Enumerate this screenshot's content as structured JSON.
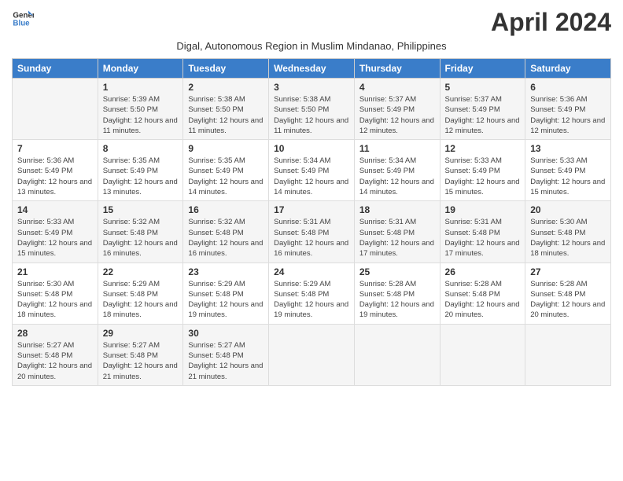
{
  "header": {
    "logo_general": "General",
    "logo_blue": "Blue",
    "title": "April 2024",
    "subtitle": "Digal, Autonomous Region in Muslim Mindanao, Philippines"
  },
  "days_of_week": [
    "Sunday",
    "Monday",
    "Tuesday",
    "Wednesday",
    "Thursday",
    "Friday",
    "Saturday"
  ],
  "weeks": [
    [
      {
        "day": "",
        "info": ""
      },
      {
        "day": "1",
        "info": "Sunrise: 5:39 AM\nSunset: 5:50 PM\nDaylight: 12 hours\nand 11 minutes."
      },
      {
        "day": "2",
        "info": "Sunrise: 5:38 AM\nSunset: 5:50 PM\nDaylight: 12 hours\nand 11 minutes."
      },
      {
        "day": "3",
        "info": "Sunrise: 5:38 AM\nSunset: 5:50 PM\nDaylight: 12 hours\nand 11 minutes."
      },
      {
        "day": "4",
        "info": "Sunrise: 5:37 AM\nSunset: 5:49 PM\nDaylight: 12 hours\nand 12 minutes."
      },
      {
        "day": "5",
        "info": "Sunrise: 5:37 AM\nSunset: 5:49 PM\nDaylight: 12 hours\nand 12 minutes."
      },
      {
        "day": "6",
        "info": "Sunrise: 5:36 AM\nSunset: 5:49 PM\nDaylight: 12 hours\nand 12 minutes."
      }
    ],
    [
      {
        "day": "7",
        "info": "Sunrise: 5:36 AM\nSunset: 5:49 PM\nDaylight: 12 hours\nand 13 minutes."
      },
      {
        "day": "8",
        "info": "Sunrise: 5:35 AM\nSunset: 5:49 PM\nDaylight: 12 hours\nand 13 minutes."
      },
      {
        "day": "9",
        "info": "Sunrise: 5:35 AM\nSunset: 5:49 PM\nDaylight: 12 hours\nand 14 minutes."
      },
      {
        "day": "10",
        "info": "Sunrise: 5:34 AM\nSunset: 5:49 PM\nDaylight: 12 hours\nand 14 minutes."
      },
      {
        "day": "11",
        "info": "Sunrise: 5:34 AM\nSunset: 5:49 PM\nDaylight: 12 hours\nand 14 minutes."
      },
      {
        "day": "12",
        "info": "Sunrise: 5:33 AM\nSunset: 5:49 PM\nDaylight: 12 hours\nand 15 minutes."
      },
      {
        "day": "13",
        "info": "Sunrise: 5:33 AM\nSunset: 5:49 PM\nDaylight: 12 hours\nand 15 minutes."
      }
    ],
    [
      {
        "day": "14",
        "info": "Sunrise: 5:33 AM\nSunset: 5:49 PM\nDaylight: 12 hours\nand 15 minutes."
      },
      {
        "day": "15",
        "info": "Sunrise: 5:32 AM\nSunset: 5:48 PM\nDaylight: 12 hours\nand 16 minutes."
      },
      {
        "day": "16",
        "info": "Sunrise: 5:32 AM\nSunset: 5:48 PM\nDaylight: 12 hours\nand 16 minutes."
      },
      {
        "day": "17",
        "info": "Sunrise: 5:31 AM\nSunset: 5:48 PM\nDaylight: 12 hours\nand 16 minutes."
      },
      {
        "day": "18",
        "info": "Sunrise: 5:31 AM\nSunset: 5:48 PM\nDaylight: 12 hours\nand 17 minutes."
      },
      {
        "day": "19",
        "info": "Sunrise: 5:31 AM\nSunset: 5:48 PM\nDaylight: 12 hours\nand 17 minutes."
      },
      {
        "day": "20",
        "info": "Sunrise: 5:30 AM\nSunset: 5:48 PM\nDaylight: 12 hours\nand 18 minutes."
      }
    ],
    [
      {
        "day": "21",
        "info": "Sunrise: 5:30 AM\nSunset: 5:48 PM\nDaylight: 12 hours\nand 18 minutes."
      },
      {
        "day": "22",
        "info": "Sunrise: 5:29 AM\nSunset: 5:48 PM\nDaylight: 12 hours\nand 18 minutes."
      },
      {
        "day": "23",
        "info": "Sunrise: 5:29 AM\nSunset: 5:48 PM\nDaylight: 12 hours\nand 19 minutes."
      },
      {
        "day": "24",
        "info": "Sunrise: 5:29 AM\nSunset: 5:48 PM\nDaylight: 12 hours\nand 19 minutes."
      },
      {
        "day": "25",
        "info": "Sunrise: 5:28 AM\nSunset: 5:48 PM\nDaylight: 12 hours\nand 19 minutes."
      },
      {
        "day": "26",
        "info": "Sunrise: 5:28 AM\nSunset: 5:48 PM\nDaylight: 12 hours\nand 20 minutes."
      },
      {
        "day": "27",
        "info": "Sunrise: 5:28 AM\nSunset: 5:48 PM\nDaylight: 12 hours\nand 20 minutes."
      }
    ],
    [
      {
        "day": "28",
        "info": "Sunrise: 5:27 AM\nSunset: 5:48 PM\nDaylight: 12 hours\nand 20 minutes."
      },
      {
        "day": "29",
        "info": "Sunrise: 5:27 AM\nSunset: 5:48 PM\nDaylight: 12 hours\nand 21 minutes."
      },
      {
        "day": "30",
        "info": "Sunrise: 5:27 AM\nSunset: 5:48 PM\nDaylight: 12 hours\nand 21 minutes."
      },
      {
        "day": "",
        "info": ""
      },
      {
        "day": "",
        "info": ""
      },
      {
        "day": "",
        "info": ""
      },
      {
        "day": "",
        "info": ""
      }
    ]
  ]
}
